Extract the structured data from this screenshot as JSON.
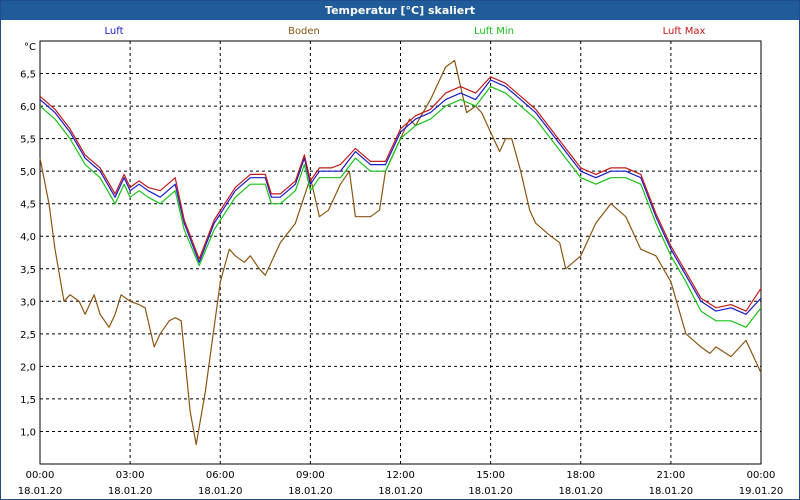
{
  "window": {
    "title": "Temperatur [°C] skaliert"
  },
  "chart_data": {
    "type": "line",
    "title": "Temperatur [°C] skaliert",
    "ylabel": "°C",
    "xlabel": "",
    "ylim": [
      0.5,
      7.0
    ],
    "xlim": [
      0,
      24
    ],
    "grid": true,
    "legend_position": "top",
    "y_ticks": [
      "1,0",
      "1,5",
      "2,0",
      "2,5",
      "3,0",
      "3,5",
      "4,0",
      "4,5",
      "5,0",
      "5,5",
      "6,0",
      "6,5"
    ],
    "y_tick_values": [
      1.0,
      1.5,
      2.0,
      2.5,
      3.0,
      3.5,
      4.0,
      4.5,
      5.0,
      5.5,
      6.0,
      6.5
    ],
    "x_ticks": [
      {
        "time": "00:00",
        "date": "18.01.20"
      },
      {
        "time": "03:00",
        "date": "18.01.20"
      },
      {
        "time": "06:00",
        "date": "18.01.20"
      },
      {
        "time": "09:00",
        "date": "18.01.20"
      },
      {
        "time": "12:00",
        "date": "18.01.20"
      },
      {
        "time": "15:00",
        "date": "18.01.20"
      },
      {
        "time": "18:00",
        "date": "18.01.20"
      },
      {
        "time": "21:00",
        "date": "18.01.20"
      },
      {
        "time": "00:00",
        "date": "19.01.20"
      }
    ],
    "x_tick_values": [
      0,
      3,
      6,
      9,
      12,
      15,
      18,
      21,
      24
    ],
    "series": [
      {
        "name": "Luft",
        "color": "#1a1acc",
        "x": [
          0,
          0.5,
          1,
          1.5,
          2,
          2.5,
          2.8,
          3,
          3.3,
          3.6,
          4,
          4.5,
          4.8,
          5.3,
          5.8,
          6.5,
          7,
          7.5,
          7.7,
          8,
          8.5,
          8.8,
          9,
          9.3,
          9.7,
          10,
          10.5,
          11,
          11.5,
          12,
          12.5,
          13,
          13.5,
          14,
          14.5,
          15,
          15.5,
          16,
          16.5,
          17,
          17.5,
          18,
          18.5,
          19,
          19.5,
          20,
          20.5,
          21,
          21.5,
          22,
          22.5,
          23,
          23.5,
          24
        ],
        "values": [
          6.1,
          5.9,
          5.6,
          5.2,
          5.0,
          4.6,
          4.9,
          4.7,
          4.8,
          4.7,
          4.6,
          4.8,
          4.2,
          3.6,
          4.2,
          4.7,
          4.9,
          4.9,
          4.6,
          4.6,
          4.8,
          5.2,
          4.8,
          5.0,
          5.0,
          5.0,
          5.3,
          5.1,
          5.1,
          5.6,
          5.8,
          5.9,
          6.1,
          6.2,
          6.1,
          6.4,
          6.3,
          6.1,
          5.9,
          5.6,
          5.3,
          5.0,
          4.9,
          5.0,
          5.0,
          4.9,
          4.3,
          3.8,
          3.4,
          3.0,
          2.85,
          2.9,
          2.8,
          3.05
        ]
      },
      {
        "name": "Boden",
        "color": "#8b5513",
        "x": [
          0,
          0.3,
          0.5,
          0.8,
          1,
          1.3,
          1.5,
          1.8,
          2,
          2.3,
          2.5,
          2.7,
          3,
          3.3,
          3.5,
          3.8,
          4,
          4.3,
          4.5,
          4.7,
          5,
          5.2,
          5.5,
          6,
          6.3,
          6.5,
          6.8,
          7,
          7.3,
          7.5,
          8,
          8.5,
          9,
          9.3,
          9.6,
          10,
          10.3,
          10.5,
          11,
          11.3,
          11.5,
          12,
          12.3,
          12.5,
          13,
          13.3,
          13.5,
          13.8,
          14,
          14.2,
          14.5,
          14.7,
          15,
          15.3,
          15.5,
          15.7,
          16,
          16.3,
          16.5,
          17,
          17.3,
          17.5,
          18,
          18.5,
          19,
          19.5,
          20,
          20.5,
          21,
          21.5,
          22,
          22.3,
          22.5,
          23,
          23.5,
          24
        ],
        "values": [
          5.2,
          4.5,
          3.8,
          3.0,
          3.1,
          3.0,
          2.8,
          3.1,
          2.8,
          2.6,
          2.8,
          3.1,
          3.0,
          2.95,
          2.9,
          2.3,
          2.5,
          2.7,
          2.75,
          2.7,
          1.3,
          0.8,
          1.6,
          3.3,
          3.8,
          3.7,
          3.6,
          3.7,
          3.5,
          3.4,
          3.9,
          4.2,
          4.9,
          4.3,
          4.4,
          4.8,
          5.0,
          4.3,
          4.3,
          4.4,
          5.0,
          5.5,
          5.8,
          5.7,
          6.1,
          6.4,
          6.6,
          6.7,
          6.3,
          5.9,
          6.0,
          5.9,
          5.6,
          5.3,
          5.5,
          5.5,
          5.0,
          4.4,
          4.2,
          4.0,
          3.9,
          3.5,
          3.7,
          4.2,
          4.5,
          4.3,
          3.8,
          3.7,
          3.3,
          2.5,
          2.3,
          2.2,
          2.3,
          2.15,
          2.4,
          1.9
        ]
      },
      {
        "name": "Luft Min",
        "color": "#19c119",
        "x": [
          0,
          0.5,
          1,
          1.5,
          2,
          2.5,
          2.8,
          3,
          3.3,
          3.6,
          4,
          4.5,
          4.8,
          5.3,
          5.8,
          6.5,
          7,
          7.5,
          7.7,
          8,
          8.5,
          8.8,
          9,
          9.3,
          9.7,
          10,
          10.5,
          11,
          11.5,
          12,
          12.5,
          13,
          13.5,
          14,
          14.5,
          15,
          15.5,
          16,
          16.5,
          17,
          17.5,
          18,
          18.5,
          19,
          19.5,
          20,
          20.5,
          21,
          21.5,
          22,
          22.5,
          23,
          23.5,
          24
        ],
        "values": [
          6.0,
          5.8,
          5.5,
          5.1,
          4.9,
          4.5,
          4.8,
          4.6,
          4.7,
          4.6,
          4.5,
          4.7,
          4.1,
          3.55,
          4.1,
          4.6,
          4.8,
          4.8,
          4.5,
          4.5,
          4.7,
          5.1,
          4.7,
          4.9,
          4.9,
          4.9,
          5.2,
          5.0,
          5.0,
          5.5,
          5.7,
          5.8,
          6.0,
          6.1,
          6.0,
          6.3,
          6.2,
          6.0,
          5.8,
          5.5,
          5.2,
          4.9,
          4.8,
          4.9,
          4.9,
          4.8,
          4.2,
          3.7,
          3.3,
          2.85,
          2.7,
          2.7,
          2.6,
          2.9
        ]
      },
      {
        "name": "Luft Max",
        "color": "#c41a1a",
        "x": [
          0,
          0.5,
          1,
          1.5,
          2,
          2.5,
          2.8,
          3,
          3.3,
          3.6,
          4,
          4.5,
          4.8,
          5.3,
          5.8,
          6.5,
          7,
          7.5,
          7.7,
          8,
          8.5,
          8.8,
          9,
          9.3,
          9.7,
          10,
          10.5,
          11,
          11.5,
          12,
          12.5,
          13,
          13.5,
          14,
          14.5,
          15,
          15.5,
          16,
          16.5,
          17,
          17.5,
          18,
          18.5,
          19,
          19.5,
          20,
          20.5,
          21,
          21.5,
          22,
          22.5,
          23,
          23.5,
          24
        ],
        "values": [
          6.15,
          5.95,
          5.65,
          5.25,
          5.05,
          4.65,
          4.95,
          4.75,
          4.85,
          4.75,
          4.7,
          4.9,
          4.25,
          3.65,
          4.25,
          4.75,
          4.95,
          4.95,
          4.65,
          4.65,
          4.85,
          5.25,
          4.85,
          5.05,
          5.05,
          5.1,
          5.35,
          5.15,
          5.15,
          5.65,
          5.85,
          5.95,
          6.2,
          6.3,
          6.2,
          6.45,
          6.35,
          6.15,
          5.95,
          5.65,
          5.35,
          5.05,
          4.95,
          5.05,
          5.05,
          4.95,
          4.35,
          3.85,
          3.45,
          3.05,
          2.9,
          2.95,
          2.85,
          3.2
        ]
      }
    ]
  }
}
